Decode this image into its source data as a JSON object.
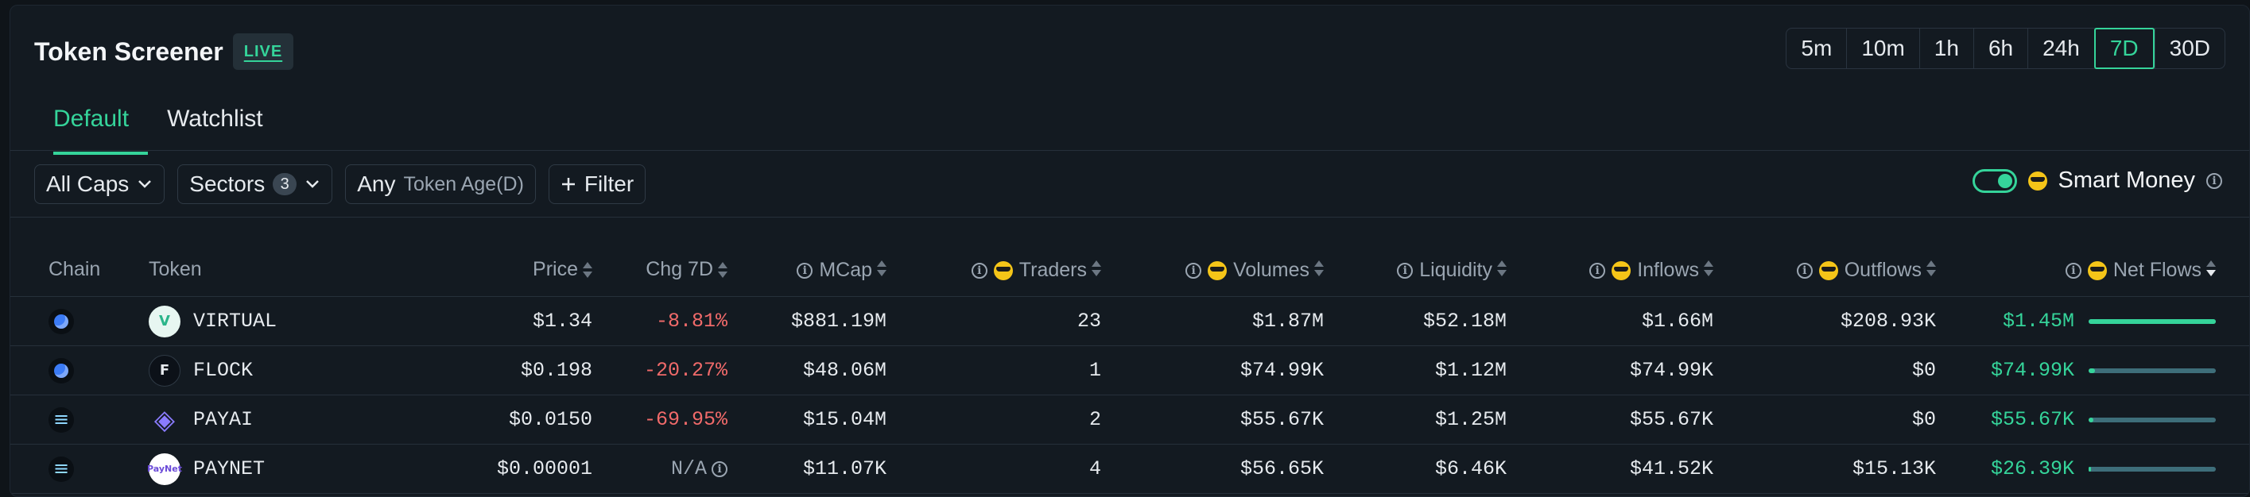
{
  "header": {
    "title": "Token Screener",
    "live_label": "LIVE"
  },
  "time_ranges": [
    "5m",
    "10m",
    "1h",
    "6h",
    "24h",
    "7D",
    "30D"
  ],
  "time_range_selected": "7D",
  "tabs": [
    {
      "label": "Default",
      "active": true
    },
    {
      "label": "Watchlist",
      "active": false
    }
  ],
  "filters": {
    "caps_label": "All Caps",
    "sectors_label": "Sectors",
    "sectors_count": "3",
    "age_value": "Any",
    "age_label": "Token Age(D)",
    "filter_label": "Filter"
  },
  "smart_money": {
    "label": "Smart Money",
    "enabled": true
  },
  "table": {
    "columns": {
      "chain": "Chain",
      "token": "Token",
      "price": "Price",
      "chg": "Chg 7D",
      "mcap": "MCap",
      "traders": "Traders",
      "volumes": "Volumes",
      "liquidity": "Liquidity",
      "inflows": "Inflows",
      "outflows": "Outflows",
      "netflows": "Net Flows"
    },
    "rows": [
      {
        "chain": "base",
        "token": "VIRTUAL",
        "icon": "virtual-icon",
        "price": "$1.34",
        "chg": "-8.81%",
        "mcap": "$881.19M",
        "traders": "23",
        "volumes": "$1.87M",
        "liquidity": "$52.18M",
        "inflows": "$1.66M",
        "outflows": "$208.93K",
        "netflows": "$1.45M",
        "net_share": 1.0
      },
      {
        "chain": "base",
        "token": "FLOCK",
        "icon": "flock-icon",
        "price": "$0.198",
        "chg": "-20.27%",
        "mcap": "$48.06M",
        "traders": "1",
        "volumes": "$74.99K",
        "liquidity": "$1.12M",
        "inflows": "$74.99K",
        "outflows": "$0",
        "netflows": "$74.99K",
        "net_share": 0.05
      },
      {
        "chain": "solana",
        "token": "PAYAI",
        "icon": "payai-icon",
        "price": "$0.0150",
        "chg": "-69.95%",
        "mcap": "$15.04M",
        "traders": "2",
        "volumes": "$55.67K",
        "liquidity": "$1.25M",
        "inflows": "$55.67K",
        "outflows": "$0",
        "netflows": "$55.67K",
        "net_share": 0.04
      },
      {
        "chain": "solana",
        "token": "PAYNET",
        "icon": "paynet-icon",
        "price": "$0.00001",
        "chg": "N/A",
        "mcap": "$11.07K",
        "traders": "4",
        "volumes": "$56.65K",
        "liquidity": "$6.46K",
        "inflows": "$41.52K",
        "outflows": "$15.13K",
        "netflows": "$26.39K",
        "net_share": 0.02
      }
    ]
  },
  "colors": {
    "accent": "#35d49a",
    "negative": "#f06a6a",
    "background": "#131a21"
  }
}
